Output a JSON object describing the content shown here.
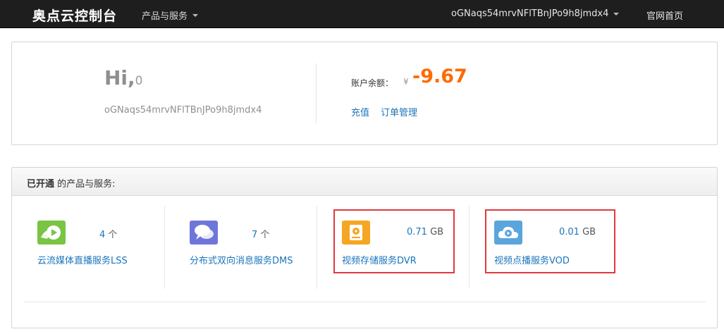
{
  "navbar": {
    "brand": "奥点云控制台",
    "products_menu": "产品与服务",
    "user_menu": "oGNaqs54mrvNFlTBnJPo9h8jmdx4",
    "home_link": "官网首页"
  },
  "account": {
    "greeting": "Hi,",
    "greeting_name": "0",
    "username": "oGNaqs54mrvNFlTBnJPo9h8jmdx4",
    "balance_label": "账户余额：",
    "currency_symbol": "¥",
    "balance": "-9.67",
    "recharge_link": "充值",
    "orders_link": "订单管理"
  },
  "services": {
    "header_bold": "已开通",
    "header_rest": " 的产品与服务:",
    "items": [
      {
        "name": "云流媒体直播服务LSS",
        "count": "4",
        "unit": "个",
        "icon": "live-play-icon",
        "color": "#79c543"
      },
      {
        "name": "分布式双向消息服务DMS",
        "count": "7",
        "unit": "个",
        "icon": "chat-bubbles-icon",
        "color": "#6f76d9"
      },
      {
        "name": "视频存储服务DVR",
        "count": "0.71",
        "unit": "GB",
        "icon": "hard-disk-icon",
        "color": "#f5a623"
      },
      {
        "name": "视频点播服务VOD",
        "count": "0.01",
        "unit": "GB",
        "icon": "cloud-play-icon",
        "color": "#5aa6dc"
      }
    ]
  }
}
